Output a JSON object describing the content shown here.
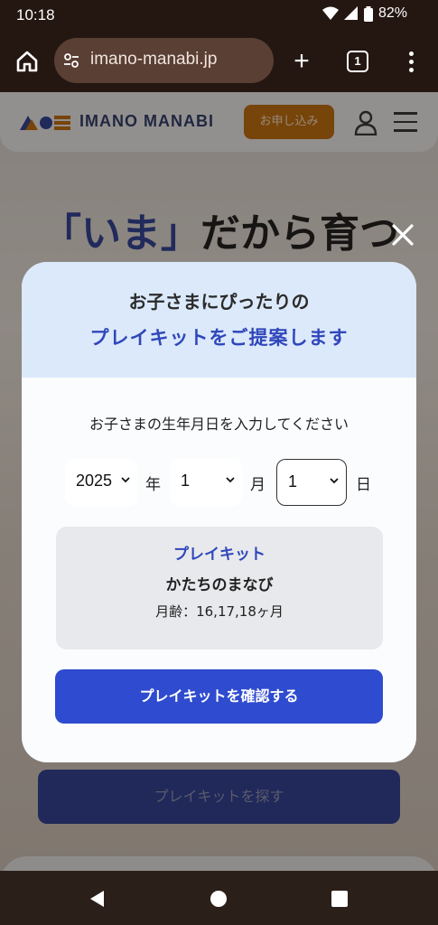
{
  "status_bar": {
    "time": "10:18",
    "battery": "82%"
  },
  "browser": {
    "url": "imano-manabi.jp",
    "tab_count": "1"
  },
  "site": {
    "logo_text": "IMANO MANABI",
    "apply_label": "お申し込み",
    "hero_accent": "「いま」",
    "hero_rest": "だから育つ",
    "page_cta": "プレイキットを探す"
  },
  "modal": {
    "title_line1": "お子さまにぴったりの",
    "title_line2": "プレイキットをご提案します",
    "prompt": "お子さまの生年月日を入力してください",
    "year_value": "2025",
    "year_unit": "年",
    "month_value": "1",
    "month_unit": "月",
    "day_value": "1",
    "day_unit": "日",
    "kit_label": "プレイキット",
    "kit_name": "かたちのまなび",
    "kit_age": "月齢：16,17,18ヶ月",
    "confirm_label": "プレイキットを確認する"
  },
  "colors": {
    "accent_blue": "#2f4bcf",
    "apply_orange": "#c06b0c",
    "modal_header_bg": "#dbe9fa"
  }
}
